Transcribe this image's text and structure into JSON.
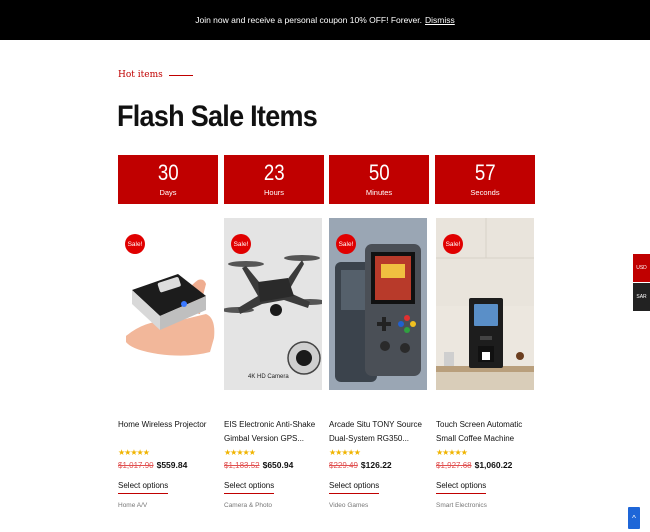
{
  "announcement": {
    "text": "Join now and receive a personal coupon 10% OFF! Forever.",
    "dismiss": "Dismiss"
  },
  "section": {
    "kicker": "Hot items",
    "title": "Flash Sale Items"
  },
  "countdown": [
    {
      "value": "30",
      "unit": "Days"
    },
    {
      "value": "23",
      "unit": "Hours"
    },
    {
      "value": "50",
      "unit": "Minutes"
    },
    {
      "value": "57",
      "unit": "Seconds"
    }
  ],
  "products": [
    {
      "badge": "Sale!",
      "name": "Home Wireless Projector",
      "stars": "★★★★★",
      "old_price": "$1,017.90",
      "price": "$559.84",
      "cta": "Select options",
      "category": "Home A/V"
    },
    {
      "badge": "Sale!",
      "name": "EIS Electronic Anti-Shake Gimbal Version GPS...",
      "stars": "★★★★★",
      "old_price": "$1,183.52",
      "price": "$650.94",
      "cta": "Select options",
      "category": "Camera & Photo",
      "image_caption": "4K HD Camera"
    },
    {
      "badge": "Sale!",
      "name": "Arcade Situ TONY Source Dual-System RG350...",
      "stars": "★★★★★",
      "old_price": "$229.49",
      "price": "$126.22",
      "cta": "Select options",
      "category": "Video Games"
    },
    {
      "badge": "Sale!",
      "name": "Touch Screen Automatic Small Coffee Machine",
      "stars": "★★★★★",
      "old_price": "$1,927.68",
      "price": "$1,060.22",
      "cta": "Select options",
      "category": "Smart Electronics"
    }
  ],
  "currency": {
    "usd": "USD",
    "sar": "SAR"
  },
  "scroll_top": "^",
  "colors": {
    "accent": "#c00000",
    "sale_badge": "#e00000",
    "stars": "#f0b400",
    "old_price": "#e05050",
    "scroll_top": "#1e66d8"
  },
  "icons": {
    "rating": "star-icon",
    "scroll_top": "chevron-up-icon"
  }
}
